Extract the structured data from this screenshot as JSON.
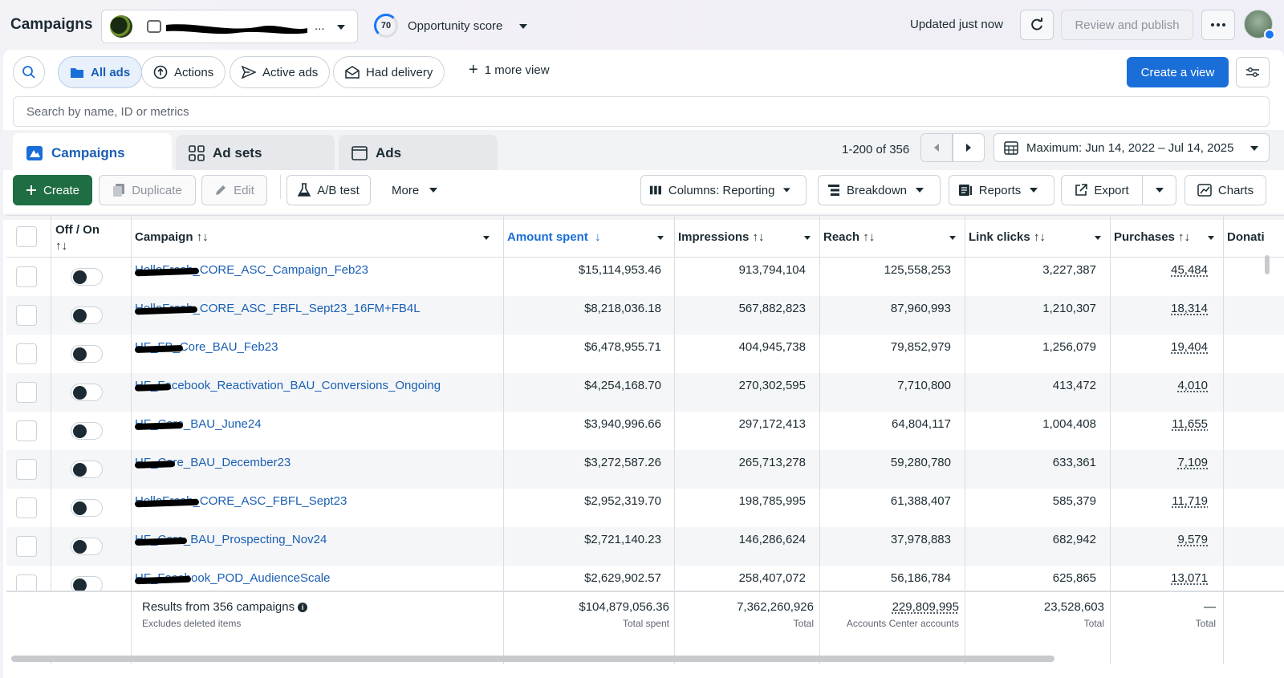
{
  "header": {
    "title": "Campaigns",
    "account_name_suffix": "...",
    "opportunity_score": "70",
    "opportunity_label": "Opportunity score",
    "updated_text": "Updated just now",
    "review_publish_label": "Review and publish"
  },
  "views": {
    "all_ads": "All ads",
    "actions": "Actions",
    "active_ads": "Active ads",
    "had_delivery": "Had delivery",
    "more_view": "1 more view",
    "create_view": "Create a view"
  },
  "search": {
    "placeholder": "Search by name, ID or metrics"
  },
  "tabs": {
    "campaigns": "Campaigns",
    "ad_sets": "Ad sets",
    "ads": "Ads"
  },
  "pagination": {
    "range": "1-200 of 356"
  },
  "date_range": "Maximum: Jun 14, 2022 – Jul 14, 2025",
  "toolbar": {
    "create": "Create",
    "duplicate": "Duplicate",
    "edit": "Edit",
    "ab_test": "A/B test",
    "more": "More",
    "columns": "Columns: Reporting",
    "breakdown": "Breakdown",
    "reports": "Reports",
    "export": "Export",
    "charts": "Charts"
  },
  "columns": {
    "off_on_1": "Off / On",
    "off_on_2": "↑↓",
    "campaign": "Campaign ↑↓",
    "amount_spent": "Amount spent",
    "amount_arrow": "↓",
    "impressions": "Impressions ↑↓",
    "reach": "Reach ↑↓",
    "link_clicks": "Link clicks ↑↓",
    "purchases": "Purchases ↑↓",
    "donations": "Donati"
  },
  "rows": [
    {
      "name": "HelloFresh_CORE_ASC_Campaign_Feb23",
      "amount": "$15,114,953.46",
      "impressions": "913,794,104",
      "reach": "125,558,253",
      "clicks": "3,227,387",
      "purchases": "45,484",
      "on": true
    },
    {
      "name": "HelloFresh_CORE_ASC_FBFL_Sept23_16FM+FB4L",
      "amount": "$8,218,036.18",
      "impressions": "567,882,823",
      "reach": "87,960,993",
      "clicks": "1,210,307",
      "purchases": "18,314",
      "on": true
    },
    {
      "name": "HF_FB_Core_BAU_Feb23",
      "amount": "$6,478,955.71",
      "impressions": "404,945,738",
      "reach": "79,852,979",
      "clicks": "1,256,079",
      "purchases": "19,404",
      "on": true
    },
    {
      "name": "HF_Facebook_Reactivation_BAU_Conversions_Ongoing",
      "amount": "$4,254,168.70",
      "impressions": "270,302,595",
      "reach": "7,710,800",
      "clicks": "413,472",
      "purchases": "4,010",
      "on": true
    },
    {
      "name": "HF_Core_BAU_June24",
      "amount": "$3,940,996.66",
      "impressions": "297,172,413",
      "reach": "64,804,117",
      "clicks": "1,004,408",
      "purchases": "11,655",
      "on": true
    },
    {
      "name": "HF_Core_BAU_December23",
      "amount": "$3,272,587.26",
      "impressions": "265,713,278",
      "reach": "59,280,780",
      "clicks": "633,361",
      "purchases": "7,109",
      "on": true
    },
    {
      "name": "HelloFresh_CORE_ASC_FBFL_Sept23",
      "amount": "$2,952,319.70",
      "impressions": "198,785,995",
      "reach": "61,388,407",
      "clicks": "585,379",
      "purchases": "11,719",
      "on": true
    },
    {
      "name": "HF_Core_BAU_Prospecting_Nov24",
      "amount": "$2,721,140.23",
      "impressions": "146,286,624",
      "reach": "37,978,883",
      "clicks": "682,942",
      "purchases": "9,579",
      "on": true
    },
    {
      "name": "HF_Facebook_POD_AudienceScale",
      "amount": "$2,629,902.57",
      "impressions": "258,407,072",
      "reach": "56,186,784",
      "clicks": "625,865",
      "purchases": "13,071",
      "on": true
    }
  ],
  "footer": {
    "results": "Results from 356 campaigns",
    "excludes": "Excludes deleted items",
    "amount": "$104,879,056.36",
    "amount_sub": "Total spent",
    "impressions": "7,362,260,926",
    "impressions_sub": "Total",
    "reach": "229,809,995",
    "reach_sub": "Accounts Center accounts",
    "clicks": "23,528,603",
    "clicks_sub": "Total",
    "purchases": "—",
    "purchases_sub": "Total"
  },
  "colors": {
    "accent": "#1a6ed8",
    "link": "#1a5fb4",
    "create_green": "#1f6e43"
  }
}
